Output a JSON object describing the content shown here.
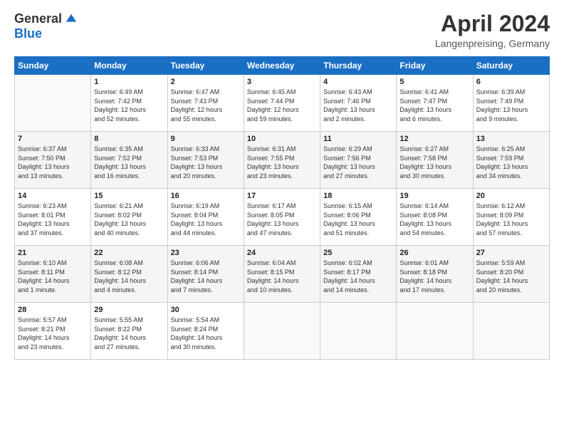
{
  "header": {
    "logo_general": "General",
    "logo_blue": "Blue",
    "title": "April 2024",
    "location": "Langenpreising, Germany"
  },
  "days_of_week": [
    "Sunday",
    "Monday",
    "Tuesday",
    "Wednesday",
    "Thursday",
    "Friday",
    "Saturday"
  ],
  "weeks": [
    [
      {
        "day": "",
        "info": ""
      },
      {
        "day": "1",
        "info": "Sunrise: 6:49 AM\nSunset: 7:42 PM\nDaylight: 12 hours\nand 52 minutes."
      },
      {
        "day": "2",
        "info": "Sunrise: 6:47 AM\nSunset: 7:43 PM\nDaylight: 12 hours\nand 55 minutes."
      },
      {
        "day": "3",
        "info": "Sunrise: 6:45 AM\nSunset: 7:44 PM\nDaylight: 12 hours\nand 59 minutes."
      },
      {
        "day": "4",
        "info": "Sunrise: 6:43 AM\nSunset: 7:46 PM\nDaylight: 13 hours\nand 2 minutes."
      },
      {
        "day": "5",
        "info": "Sunrise: 6:41 AM\nSunset: 7:47 PM\nDaylight: 13 hours\nand 6 minutes."
      },
      {
        "day": "6",
        "info": "Sunrise: 6:39 AM\nSunset: 7:49 PM\nDaylight: 13 hours\nand 9 minutes."
      }
    ],
    [
      {
        "day": "7",
        "info": "Sunrise: 6:37 AM\nSunset: 7:50 PM\nDaylight: 13 hours\nand 13 minutes."
      },
      {
        "day": "8",
        "info": "Sunrise: 6:35 AM\nSunset: 7:52 PM\nDaylight: 13 hours\nand 16 minutes."
      },
      {
        "day": "9",
        "info": "Sunrise: 6:33 AM\nSunset: 7:53 PM\nDaylight: 13 hours\nand 20 minutes."
      },
      {
        "day": "10",
        "info": "Sunrise: 6:31 AM\nSunset: 7:55 PM\nDaylight: 13 hours\nand 23 minutes."
      },
      {
        "day": "11",
        "info": "Sunrise: 6:29 AM\nSunset: 7:56 PM\nDaylight: 13 hours\nand 27 minutes."
      },
      {
        "day": "12",
        "info": "Sunrise: 6:27 AM\nSunset: 7:58 PM\nDaylight: 13 hours\nand 30 minutes."
      },
      {
        "day": "13",
        "info": "Sunrise: 6:25 AM\nSunset: 7:59 PM\nDaylight: 13 hours\nand 34 minutes."
      }
    ],
    [
      {
        "day": "14",
        "info": "Sunrise: 6:23 AM\nSunset: 8:01 PM\nDaylight: 13 hours\nand 37 minutes."
      },
      {
        "day": "15",
        "info": "Sunrise: 6:21 AM\nSunset: 8:02 PM\nDaylight: 13 hours\nand 40 minutes."
      },
      {
        "day": "16",
        "info": "Sunrise: 6:19 AM\nSunset: 8:04 PM\nDaylight: 13 hours\nand 44 minutes."
      },
      {
        "day": "17",
        "info": "Sunrise: 6:17 AM\nSunset: 8:05 PM\nDaylight: 13 hours\nand 47 minutes."
      },
      {
        "day": "18",
        "info": "Sunrise: 6:15 AM\nSunset: 8:06 PM\nDaylight: 13 hours\nand 51 minutes."
      },
      {
        "day": "19",
        "info": "Sunrise: 6:14 AM\nSunset: 8:08 PM\nDaylight: 13 hours\nand 54 minutes."
      },
      {
        "day": "20",
        "info": "Sunrise: 6:12 AM\nSunset: 8:09 PM\nDaylight: 13 hours\nand 57 minutes."
      }
    ],
    [
      {
        "day": "21",
        "info": "Sunrise: 6:10 AM\nSunset: 8:11 PM\nDaylight: 14 hours\nand 1 minute."
      },
      {
        "day": "22",
        "info": "Sunrise: 6:08 AM\nSunset: 8:12 PM\nDaylight: 14 hours\nand 4 minutes."
      },
      {
        "day": "23",
        "info": "Sunrise: 6:06 AM\nSunset: 8:14 PM\nDaylight: 14 hours\nand 7 minutes."
      },
      {
        "day": "24",
        "info": "Sunrise: 6:04 AM\nSunset: 8:15 PM\nDaylight: 14 hours\nand 10 minutes."
      },
      {
        "day": "25",
        "info": "Sunrise: 6:02 AM\nSunset: 8:17 PM\nDaylight: 14 hours\nand 14 minutes."
      },
      {
        "day": "26",
        "info": "Sunrise: 6:01 AM\nSunset: 8:18 PM\nDaylight: 14 hours\nand 17 minutes."
      },
      {
        "day": "27",
        "info": "Sunrise: 5:59 AM\nSunset: 8:20 PM\nDaylight: 14 hours\nand 20 minutes."
      }
    ],
    [
      {
        "day": "28",
        "info": "Sunrise: 5:57 AM\nSunset: 8:21 PM\nDaylight: 14 hours\nand 23 minutes."
      },
      {
        "day": "29",
        "info": "Sunrise: 5:55 AM\nSunset: 8:22 PM\nDaylight: 14 hours\nand 27 minutes."
      },
      {
        "day": "30",
        "info": "Sunrise: 5:54 AM\nSunset: 8:24 PM\nDaylight: 14 hours\nand 30 minutes."
      },
      {
        "day": "",
        "info": ""
      },
      {
        "day": "",
        "info": ""
      },
      {
        "day": "",
        "info": ""
      },
      {
        "day": "",
        "info": ""
      }
    ]
  ]
}
